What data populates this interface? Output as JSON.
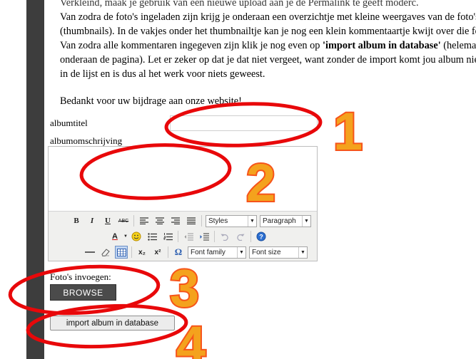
{
  "intro": {
    "line0": "Verkleind, maak je gebruik van een nieuwe upload aan je de Permalink te geeft moderc.",
    "line1": "Van zodra de foto's ingeladen zijn krijg je onderaan een overzichtje met kleine weergaves van de foto's",
    "line2": "(thumbnails). In de vakjes onder het thumbnailtje kan je nog een klein kommentaartje kwijt over die foto.",
    "line3_a": "Van zodra alle kommentaren ingegeven zijn klik je nog even op ",
    "line3_bold": "'import album in database'",
    "line3_b": " (helemaal",
    "line4": "onderaan de pagina). Let er zeker op dat je dat niet vergeet, want zonder de import komt jou album niet",
    "line5": "in de lijst en is dus al het werk voor niets geweest.",
    "thanks": "Bedankt voor uw bijdrage aan onze website!"
  },
  "form": {
    "album_title_label": "albumtitel",
    "album_title_value": "",
    "album_description_label": "albumomschrijving",
    "photos_label": "Foto's invoegen:",
    "browse_label": "BROWSE",
    "import_label": "import album in database"
  },
  "editor": {
    "styles_value": "Styles",
    "paragraph_value": "Paragraph",
    "font_family_value": "Font family",
    "font_size_value": "Font size",
    "bold_glyph": "B",
    "italic_glyph": "I",
    "underline_glyph": "U",
    "strike_glyph": "ABC",
    "subscript_glyph": "x₂",
    "superscript_glyph": "x²",
    "omega_glyph": "Ω",
    "textcolor_glyph": "A"
  },
  "annotations": {
    "numbers": [
      "1",
      "2",
      "3",
      "4"
    ],
    "color": "#f4a21d",
    "outline_color": "#e8080a"
  }
}
